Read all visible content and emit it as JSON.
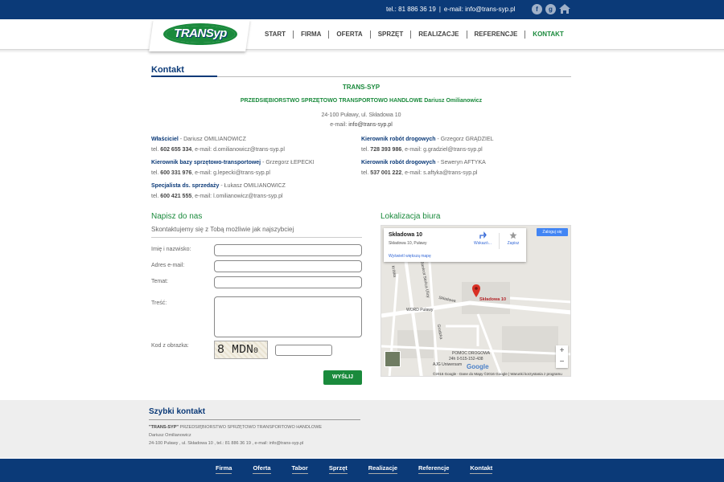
{
  "topbar": {
    "phone": "tel.: 81 886 36 19",
    "email": "e-mail: info@trans-syp.pl",
    "social": [
      {
        "icon": "facebook-icon",
        "glyph": "f"
      },
      {
        "icon": "google-plus-icon",
        "glyph": "g"
      }
    ]
  },
  "logo": {
    "text": "TRANSyp"
  },
  "nav": [
    "START",
    "FIRMA",
    "OFERTA",
    "SPRZĘT",
    "REALIZACJE",
    "REFERENCJE",
    "KONTAKT"
  ],
  "nav_active": "KONTAKT",
  "page": {
    "title": "Kontakt",
    "company": "TRANS-SYP",
    "company_full": "PRZEDSIĘBIORSTWO SPRZĘTOWO TRANSPORTOWO HANDLOWE Dariusz Omilianowicz",
    "address": "24-100 Puławy, ul. Składowa 10",
    "email_prefix": "e-mail:",
    "email": "info@trans-syp.pl"
  },
  "people": [
    {
      "role": "Właściciel",
      "name": " - Dariusz OMILIANOWICZ",
      "tel_prefix": "tel. ",
      "tel": "602 655 334",
      "email": ", e-mail: d.omilianowicz@trans-syp.pl"
    },
    {
      "role": "Kierownik bazy sprzętowo-transportowej",
      "name": " - Grzegorz ŁEPECKI",
      "tel_prefix": "tel. ",
      "tel": "600 331 976",
      "email": ", e-mail: g.lepecki@trans-syp.pl"
    },
    {
      "role": "Specjalista ds. sprzedaży",
      "name": " - Łukasz OMILIANOWICZ",
      "tel_prefix": "tel. ",
      "tel": "600 421 555",
      "email": ", e-mail: l.omilianowicz@trans-syp.pl"
    },
    {
      "role": "Kierownik robót drogowych",
      "name": " - Grzegorz GRĄDZIEL",
      "tel_prefix": "tel. ",
      "tel": "728 393 986",
      "email": ", e-mail: g.gradziel@trans-syp.pl"
    },
    {
      "role": "Kierownik robót drogowych",
      "name": " - Seweryn AFTYKA",
      "tel_prefix": "tel. ",
      "tel": "537 001 222",
      "email": ", e-mail: s.aftyka@trans-syp.pl"
    }
  ],
  "form": {
    "heading": "Napisz do nas",
    "subheading": "Skontaktujemy się z Tobą możliwie jak najszybciej",
    "labels": {
      "name": "Imię i nazwisko:",
      "email": "Adres e-mail:",
      "subject": "Temat:",
      "message": "Treść:",
      "captcha": "Kod z obrazka:"
    },
    "captcha_text": "8 MDN",
    "captcha_small": "0",
    "submit": "WYŚLIJ"
  },
  "map": {
    "heading": "Lokalizacja biura",
    "card_title": "Składowa 10",
    "card_address": "Składowa 10, Puławy",
    "card_link": "Wyświetl większą mapę",
    "directions": "Wskazó...",
    "save": "Zapisz",
    "sign_in": "Zaloguj się",
    "pin_label": "Składowa 10",
    "roads": [
      "Składowa",
      "WORD Puławy",
      "Krótka",
      "Bankrot Słońca Ulicy",
      "Grodzka"
    ],
    "poi": [
      "POMOC DROGOWA",
      "24h 0-515-152-438",
      "AJG Uniwersam"
    ],
    "attribution": "©2016 Google - Dane do Mapy ©2016 Google | Warunki korzystania z programu",
    "google": "Google",
    "zoom_in": "+",
    "zoom_out": "−"
  },
  "quick": {
    "heading": "Szybki kontakt",
    "company": "\"TRANS-SYP\"",
    "company_rest": " PRZEDSIĘBIORSTWO SPRZĘTOWO TRANSPORTOWO HANDLOWE",
    "owner": "Dariusz Omilianowicz",
    "address": "24-100 Puławy , ul. Składowa 10 , tel.: 81 886 36 19 , e-mail: info@trans-syp.pl"
  },
  "footer_nav": [
    "Firma",
    "Oferta",
    "Tabor",
    "Sprzęt",
    "Realizacje",
    "Referencje",
    "Kontakt"
  ],
  "colors": {
    "primary": "#0b3a78",
    "accent": "#1a8a3c",
    "map_pin": "#d93025"
  }
}
